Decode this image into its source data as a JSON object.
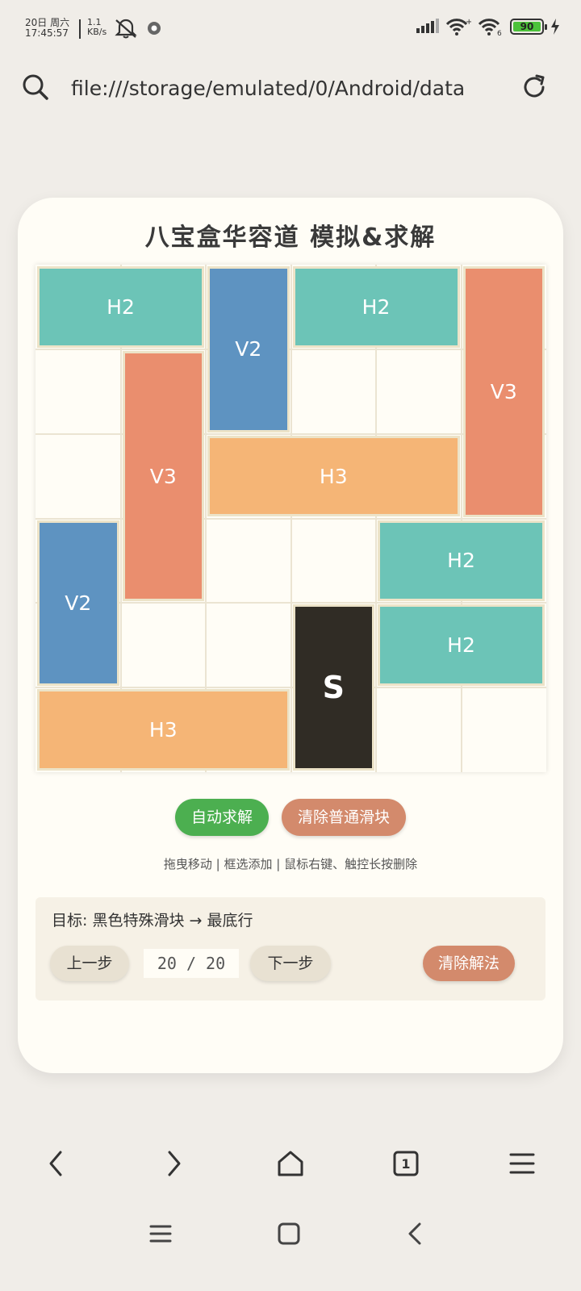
{
  "status_bar": {
    "date": "20日 周六",
    "time": "17:45:57",
    "net_speed_value": "1.1",
    "net_speed_unit": "KB/s",
    "battery": "90"
  },
  "address_bar": {
    "url": "file:///storage/emulated/0/Android/data"
  },
  "app": {
    "title": "八宝盒华容道 模拟&求解",
    "board": {
      "cols": 6,
      "rows": 6,
      "blocks": [
        {
          "label": "H2",
          "type": "H2",
          "col": 0,
          "row": 0,
          "w": 2,
          "h": 1
        },
        {
          "label": "V2",
          "type": "V2",
          "col": 2,
          "row": 0,
          "w": 1,
          "h": 2
        },
        {
          "label": "H2",
          "type": "H2",
          "col": 3,
          "row": 0,
          "w": 2,
          "h": 1
        },
        {
          "label": "V3",
          "type": "V3",
          "col": 5,
          "row": 0,
          "w": 1,
          "h": 3
        },
        {
          "label": "V3",
          "type": "V3",
          "col": 1,
          "row": 1,
          "w": 1,
          "h": 3
        },
        {
          "label": "H3",
          "type": "H3",
          "col": 2,
          "row": 2,
          "w": 3,
          "h": 1
        },
        {
          "label": "V2",
          "type": "V2",
          "col": 0,
          "row": 3,
          "w": 1,
          "h": 2
        },
        {
          "label": "H2",
          "type": "H2",
          "col": 4,
          "row": 3,
          "w": 2,
          "h": 1
        },
        {
          "label": "S",
          "type": "S",
          "col": 3,
          "row": 4,
          "w": 1,
          "h": 2
        },
        {
          "label": "H2",
          "type": "H2",
          "col": 4,
          "row": 4,
          "w": 2,
          "h": 1
        },
        {
          "label": "H3",
          "type": "H3",
          "col": 0,
          "row": 5,
          "w": 3,
          "h": 1
        }
      ]
    },
    "buttons": {
      "auto_solve": "自动求解",
      "clear_blocks": "清除普通滑块"
    },
    "hint": "拖曳移动 | 框选添加 | 鼠标右键、触控长按删除",
    "panel": {
      "goal": "目标: 黑色特殊滑块 → 最底行",
      "prev": "上一步",
      "counter": "20 / 20",
      "next": "下一步",
      "clear_solution": "清除解法"
    }
  },
  "bottom_nav": {
    "tabs_count": "1"
  },
  "colors": {
    "H2": "#6cc4b7",
    "V2": "#5e93c1",
    "V3": "#ea8e6e",
    "H3": "#f5b576",
    "S": "#302c25"
  }
}
